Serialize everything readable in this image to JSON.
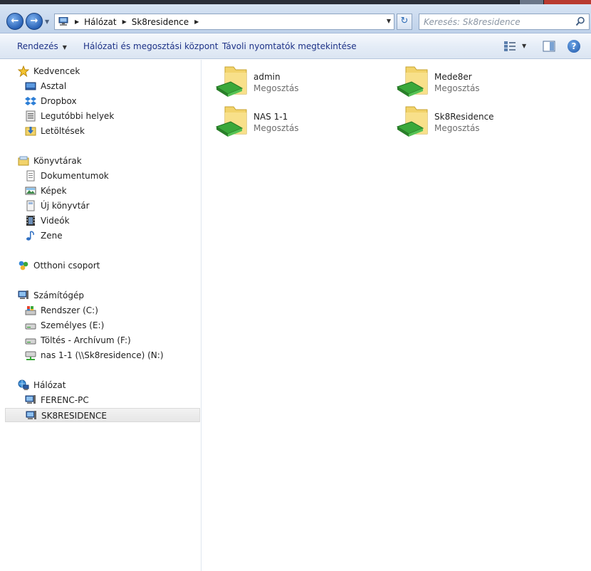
{
  "address": {
    "crumbs": [
      "Hálózat",
      "Sk8residence"
    ]
  },
  "search": {
    "placeholder": "Keresés: Sk8residence"
  },
  "toolbar": {
    "organize_label": "Rendezés",
    "network_center_label": "Hálózati és megosztási központ",
    "remote_printers_label": "Távoli nyomtatók megtekintése"
  },
  "nav": {
    "favorites": {
      "label": "Kedvencek",
      "items": [
        "Asztal",
        "Dropbox",
        "Legutóbbi helyek",
        "Letöltések"
      ]
    },
    "libraries": {
      "label": "Könyvtárak",
      "items": [
        "Dokumentumok",
        "Képek",
        "Új könyvtár",
        "Videók",
        "Zene"
      ]
    },
    "homegroup": {
      "label": "Otthoni csoport"
    },
    "computer": {
      "label": "Számítógép",
      "items": [
        "Rendszer (C:)",
        "Személyes (E:)",
        "Töltés - Archívum (F:)",
        "nas 1-1 (\\\\Sk8residence) (N:)"
      ]
    },
    "network": {
      "label": "Hálózat",
      "items": [
        "FERENC-PC",
        "SK8RESIDENCE"
      ],
      "selected": "SK8RESIDENCE"
    }
  },
  "shares": [
    {
      "name": "admin",
      "type": "Megosztás"
    },
    {
      "name": "Mede8er",
      "type": "Megosztás"
    },
    {
      "name": "NAS 1-1",
      "type": "Megosztás"
    },
    {
      "name": "Sk8Residence",
      "type": "Megosztás"
    }
  ],
  "colors": {
    "toolbar_text": "#1e3287",
    "folder_yellow": "#f2d36b",
    "share_green": "#3aa83a",
    "selection_gray": "#e8e8e8"
  }
}
